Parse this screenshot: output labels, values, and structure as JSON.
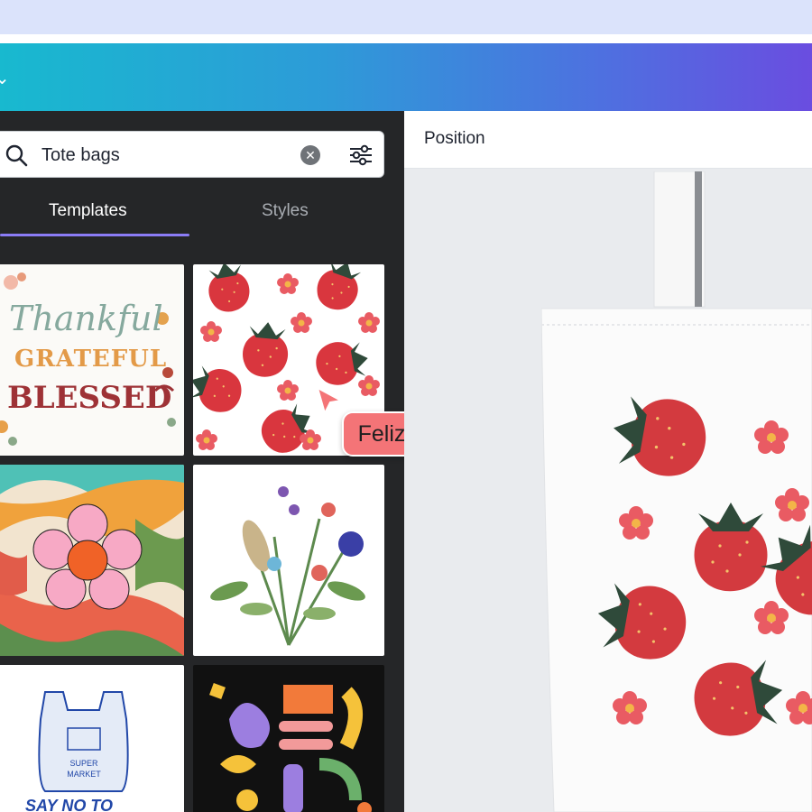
{
  "topbar": {
    "chevron_icon": "chevron-down-icon",
    "gradient": [
      "#18b9cf",
      "#6a4de0"
    ]
  },
  "search": {
    "query": "Tote bags",
    "search_icon": "search-icon",
    "clear_icon": "clear-icon",
    "filter_icon": "filter-sliders-icon"
  },
  "tabs": [
    {
      "label": "Templates",
      "active": true
    },
    {
      "label": "Styles",
      "active": false
    }
  ],
  "templates": {
    "t1": {
      "lines": [
        "Thankful",
        "GRATEFUL",
        "BLESSED"
      ]
    },
    "t5": {
      "caption": "SAY NO TO",
      "bag_text": [
        "SUPER",
        "MARKET"
      ]
    }
  },
  "collaborator": {
    "name": "Feliz",
    "color": "#f47477"
  },
  "editor": {
    "position_label": "Position"
  },
  "colors": {
    "panel": "#252628",
    "accent_underline": "#8b7cf6",
    "strawberry": "#d9363e",
    "flower": "#e95b63"
  }
}
